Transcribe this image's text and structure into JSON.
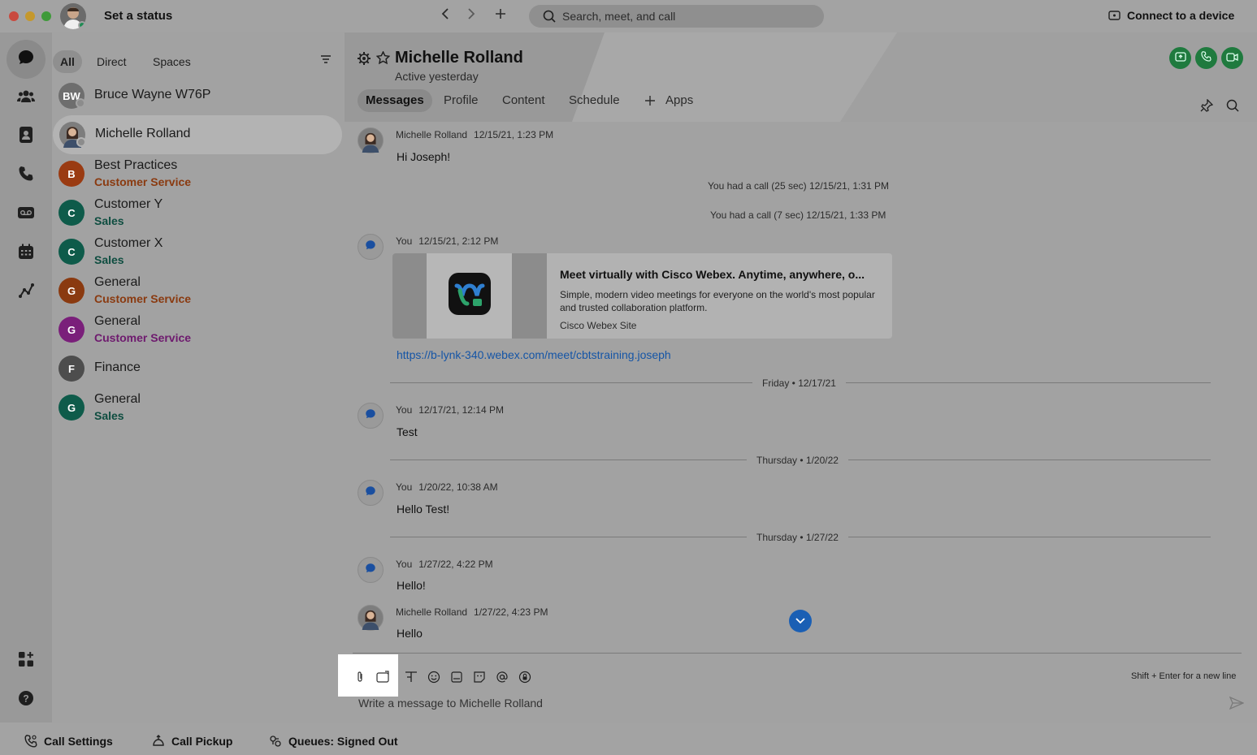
{
  "titlebar": {
    "status_label": "Set a status",
    "search_placeholder": "Search, meet, and call",
    "connect_label": "Connect to a device"
  },
  "filters": {
    "all": "All",
    "direct": "Direct",
    "spaces": "Spaces"
  },
  "conversations": [
    {
      "name": "Bruce Wayne W76P",
      "initials": "BW",
      "sub": "",
      "color": "#6e6e6e"
    },
    {
      "name": "Michelle Rolland",
      "initials": "",
      "sub": "",
      "color": "#7d7d7d"
    },
    {
      "name": "Best Practices",
      "initials": "B",
      "sub": "Customer Service",
      "color": "#9a3b12",
      "sub_color": "#8a3a10"
    },
    {
      "name": "Customer Y",
      "initials": "C",
      "sub": "Sales",
      "color": "#0e5b4a",
      "sub_color": "#0e4d40"
    },
    {
      "name": "Customer X",
      "initials": "C",
      "sub": "Sales",
      "color": "#0e5b4a",
      "sub_color": "#0e4d40"
    },
    {
      "name": "General",
      "initials": "G",
      "sub": "Customer Service",
      "color": "#8a3a10",
      "sub_color": "#8a3a10"
    },
    {
      "name": "General",
      "initials": "G",
      "sub": "Customer Service",
      "color": "#7a1f7a",
      "sub_color": "#6e1a6e"
    },
    {
      "name": "Finance",
      "initials": "F",
      "sub": "",
      "color": "#4d4d4d"
    },
    {
      "name": "General",
      "initials": "G",
      "sub": "Sales",
      "color": "#0e5b4a",
      "sub_color": "#0e4d40"
    }
  ],
  "header": {
    "name": "Michelle Rolland",
    "status": "Active yesterday",
    "tabs": [
      "Messages",
      "Profile",
      "Content",
      "Schedule",
      "Apps"
    ]
  },
  "messages": {
    "m1_author": "Michelle Rolland",
    "m1_time": "12/15/21, 1:23 PM",
    "m1_body": "Hi Joseph!",
    "call1": "You had a call (25 sec) 12/15/21, 1:31 PM",
    "call2": "You had a call (7 sec) 12/15/21, 1:33 PM",
    "m2_author": "You",
    "m2_time": "12/15/21, 2:12 PM",
    "card_title": "Meet virtually with Cisco Webex. Anytime, anywhere, o...",
    "card_desc": "Simple, modern video meetings for everyone on the world's most popular and trusted collaboration platform.",
    "card_site": "Cisco Webex Site",
    "link": "https://b-lynk-340.webex.com/meet/cbtstraining.joseph",
    "day1": "Friday • 12/17/21",
    "m3_author": "You",
    "m3_time": "12/17/21, 12:14 PM",
    "m3_body": "Test",
    "day2": "Thursday • 1/20/22",
    "m4_author": "You",
    "m4_time": "1/20/22, 10:38 AM",
    "m4_body": "Hello Test!",
    "day3": "Thursday • 1/27/22",
    "m5_author": "You",
    "m5_time": "1/27/22, 4:22 PM",
    "m5_body": "Hello!",
    "m6_author": "Michelle Rolland",
    "m6_time": "1/27/22, 4:23 PM",
    "m6_body": "Hello"
  },
  "composer": {
    "hint": "Shift + Enter for a new line",
    "placeholder": "Write a message to Michelle Rolland"
  },
  "bottom": {
    "call_settings": "Call Settings",
    "call_pickup": "Call Pickup",
    "queues": "Queues: Signed Out"
  }
}
